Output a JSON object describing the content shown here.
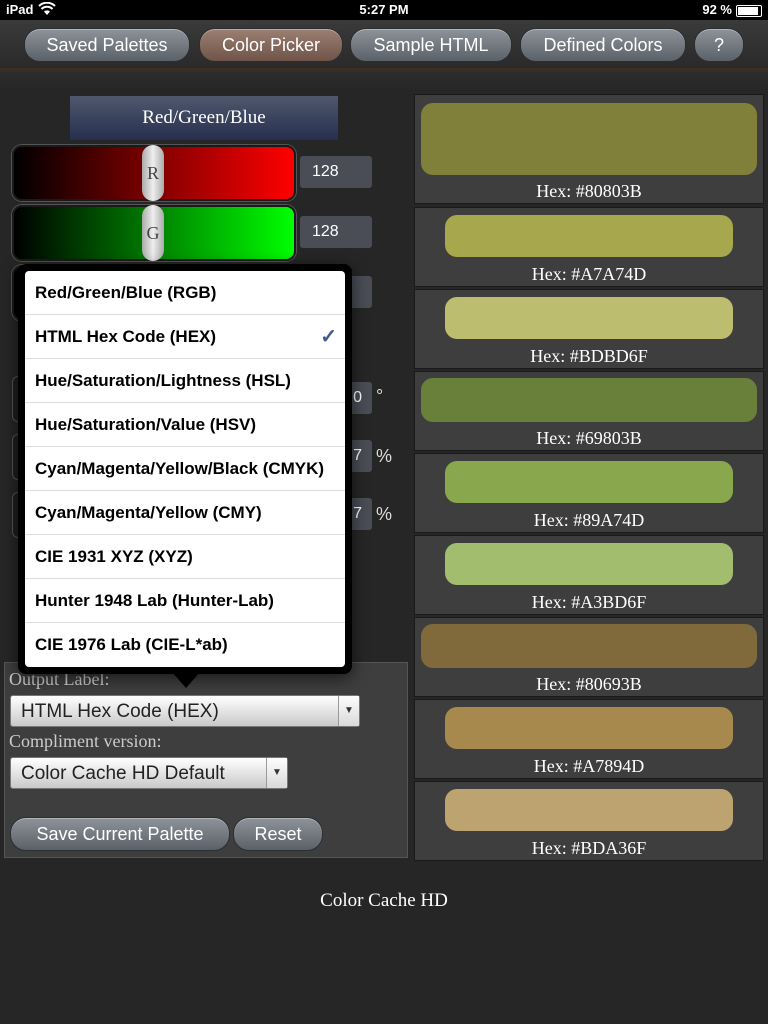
{
  "status_bar": {
    "device": "iPad",
    "time": "5:27 PM",
    "battery": "92 %",
    "battery_level": 0.92
  },
  "nav": {
    "tabs": [
      {
        "label": "Saved Palettes",
        "active": false
      },
      {
        "label": "Color Picker",
        "active": true
      },
      {
        "label": "Sample HTML",
        "active": false
      },
      {
        "label": "Defined Colors",
        "active": false
      },
      {
        "label": "?",
        "active": false
      }
    ]
  },
  "picker": {
    "mode_label": "Red/Green/Blue",
    "red": {
      "knob": "R",
      "value": "128"
    },
    "green": {
      "knob": "G",
      "value": "128"
    },
    "hs_units": {
      "hue": "°",
      "saturation": "%",
      "lightness": "%"
    },
    "partial_values": {
      "hue": "0",
      "saturation": "7",
      "lightness": "7"
    }
  },
  "popover": {
    "items": [
      {
        "label": "Red/Green/Blue (RGB)",
        "checked": false
      },
      {
        "label": "HTML Hex Code (HEX)",
        "checked": true
      },
      {
        "label": "Hue/Saturation/Lightness (HSL)",
        "checked": false
      },
      {
        "label": "Hue/Saturation/Value (HSV)",
        "checked": false
      },
      {
        "label": "Cyan/Magenta/Yellow/Black (CMYK)",
        "checked": false
      },
      {
        "label": "Cyan/Magenta/Yellow (CMY)",
        "checked": false
      },
      {
        "label": "CIE 1931 XYZ (XYZ)",
        "checked": false
      },
      {
        "label": "Hunter 1948 Lab (Hunter-Lab)",
        "checked": false
      },
      {
        "label": "CIE 1976 Lab (CIE-L*ab)",
        "checked": false
      }
    ],
    "check_glyph": "✓"
  },
  "settings": {
    "output_label_caption": "Output Label:",
    "output_label_value": "HTML Hex Code (HEX)",
    "compliment_caption": "Compliment version:",
    "compliment_value": "Color Cache HD Default",
    "save_button": "Save Current Palette",
    "reset_button": "Reset"
  },
  "footer": "Color Cache HD",
  "swatches": [
    {
      "hex": "Hex: #80803B",
      "color": "#80803B"
    },
    {
      "hex": "Hex: #A7A74D",
      "color": "#A7A74D"
    },
    {
      "hex": "Hex: #BDBD6F",
      "color": "#BDBD6F"
    },
    {
      "hex": "Hex: #69803B",
      "color": "#69803B"
    },
    {
      "hex": "Hex: #89A74D",
      "color": "#89A74D"
    },
    {
      "hex": "Hex: #A3BD6F",
      "color": "#A3BD6F"
    },
    {
      "hex": "Hex: #80693B",
      "color": "#80693B"
    },
    {
      "hex": "Hex: #A7894D",
      "color": "#A7894D"
    },
    {
      "hex": "Hex: #BDA36F",
      "color": "#BDA36F"
    }
  ]
}
